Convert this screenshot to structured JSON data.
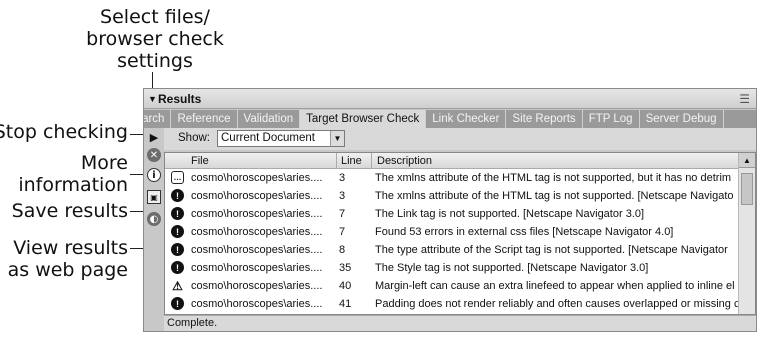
{
  "callouts": {
    "select": [
      "Select files/",
      "browser check",
      "settings"
    ],
    "stop": "Stop checking",
    "more": [
      "More",
      "information"
    ],
    "save": "Save results",
    "view": [
      "View results",
      "as web page"
    ]
  },
  "panel": {
    "title": "Results",
    "menu_icon": "☰"
  },
  "tabs": [
    "Search",
    "Reference",
    "Validation",
    "Target Browser Check",
    "Link Checker",
    "Site Reports",
    "FTP Log",
    "Server Debug"
  ],
  "active_tab": "Target Browser Check",
  "toolbar": {
    "show_label": "Show:",
    "show_value": "Current Document"
  },
  "table": {
    "headers": {
      "file": "File",
      "line": "Line",
      "description": "Description"
    },
    "rows": [
      {
        "icon": "info",
        "file": "cosmo\\horoscopes\\aries....",
        "line": "3",
        "desc": "The xmlns attribute of the HTML tag is not supported, but it has no detrim"
      },
      {
        "icon": "error",
        "file": "cosmo\\horoscopes\\aries....",
        "line": "3",
        "desc": "The xmlns attribute of the HTML tag is not supported. [Netscape Navigato"
      },
      {
        "icon": "error",
        "file": "cosmo\\horoscopes\\aries....",
        "line": "7",
        "desc": "The Link tag is not supported. [Netscape Navigator 3.0]"
      },
      {
        "icon": "error",
        "file": "cosmo\\horoscopes\\aries....",
        "line": "7",
        "desc": "Found 53 errors in external css files [Netscape Navigator 4.0]"
      },
      {
        "icon": "error",
        "file": "cosmo\\horoscopes\\aries....",
        "line": "8",
        "desc": "The type attribute of the Script tag is not supported. [Netscape Navigator"
      },
      {
        "icon": "error",
        "file": "cosmo\\horoscopes\\aries....",
        "line": "35",
        "desc": "The Style tag is not supported. [Netscape Navigator 3.0]"
      },
      {
        "icon": "warning",
        "file": "cosmo\\horoscopes\\aries....",
        "line": "40",
        "desc": "Margin-left can cause an extra linefeed to appear when applied to inline el"
      },
      {
        "icon": "error",
        "file": "cosmo\\horoscopes\\aries....",
        "line": "41",
        "desc": "Padding does not render reliably and often causes overlapped or missing c"
      }
    ]
  },
  "status": "Complete."
}
